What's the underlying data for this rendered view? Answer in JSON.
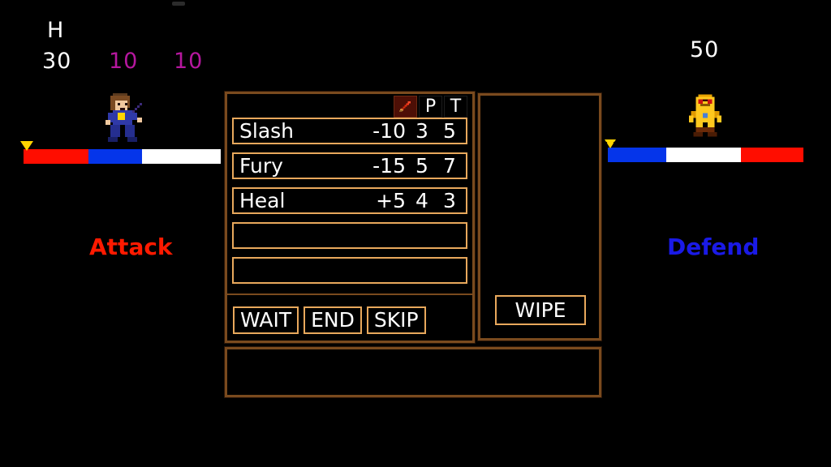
{
  "player": {
    "hp_label": "H",
    "hp_value": "30",
    "stat_mp": "10",
    "stat_sp": "10",
    "action_label": "Attack",
    "action_color": "#ff1a00",
    "bar": [
      {
        "color": "#ff0d00",
        "pct": 33
      },
      {
        "color": "#0535ea",
        "pct": 27
      },
      {
        "color": "#ffffff",
        "pct": 40
      }
    ]
  },
  "enemy": {
    "hp_value": "50",
    "action_label": "Defend",
    "action_color": "#1a1ae6",
    "bar": [
      {
        "color": "#0535ea",
        "pct": 30
      },
      {
        "color": "#ffffff",
        "pct": 38
      },
      {
        "color": "#ff0d00",
        "pct": 32
      }
    ]
  },
  "skill_window": {
    "columns": [
      {
        "key": "sword",
        "label": "",
        "icon": "sword-icon"
      },
      {
        "key": "p",
        "label": "P"
      },
      {
        "key": "t",
        "label": "T"
      }
    ],
    "skills": [
      {
        "name": "Slash",
        "power": "-10",
        "p": "3",
        "t": "5",
        "empty": false
      },
      {
        "name": "Fury",
        "power": "-15",
        "p": "5",
        "t": "7",
        "empty": false
      },
      {
        "name": "Heal",
        "power": "+5",
        "p": "4",
        "t": "3",
        "empty": false
      },
      {
        "name": "",
        "power": "",
        "p": "",
        "t": "",
        "empty": true
      },
      {
        "name": "",
        "power": "",
        "p": "",
        "t": "",
        "empty": true
      }
    ],
    "commands": [
      {
        "label": "WAIT"
      },
      {
        "label": "END"
      },
      {
        "label": "SKIP"
      }
    ]
  },
  "side_window": {
    "wipe_label": "WIPE"
  },
  "message_window": {
    "text": ""
  },
  "theme": {
    "frame_border": "#7a4a1e",
    "slot_border": "#e8a85c",
    "sword_bg": "#4d0f06",
    "marker": "#ffd400"
  }
}
